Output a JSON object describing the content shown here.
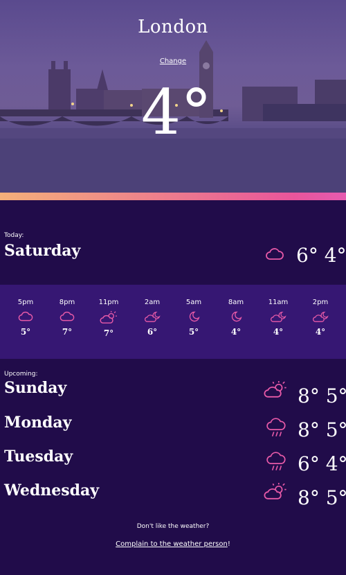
{
  "header": {
    "city": "London",
    "change_label": "Change",
    "current_temp": "4°"
  },
  "today": {
    "label": "Today:",
    "day": "Saturday",
    "icon": "cloud-icon",
    "high": "6°",
    "low": "4°"
  },
  "hourly": [
    {
      "time": "5pm",
      "icon": "cloud-icon",
      "temp": "5°"
    },
    {
      "time": "8pm",
      "icon": "cloud-icon",
      "temp": "7°"
    },
    {
      "time": "11pm",
      "icon": "partly-cloudy-sun-icon",
      "temp": "7°"
    },
    {
      "time": "2am",
      "icon": "partly-cloudy-moon-icon",
      "temp": "6°"
    },
    {
      "time": "5am",
      "icon": "moon-icon",
      "temp": "5°"
    },
    {
      "time": "8am",
      "icon": "moon-icon",
      "temp": "4°"
    },
    {
      "time": "11am",
      "icon": "partly-cloudy-moon-icon",
      "temp": "4°"
    },
    {
      "time": "2pm",
      "icon": "partly-cloudy-moon-icon",
      "temp": "4°"
    }
  ],
  "upcoming": {
    "label": "Upcoming:",
    "days": [
      {
        "day": "Sunday",
        "icon": "partly-cloudy-sun-icon",
        "high": "8°",
        "low": "5°"
      },
      {
        "day": "Monday",
        "icon": "rain-cloud-icon",
        "high": "8°",
        "low": "5°"
      },
      {
        "day": "Tuesday",
        "icon": "rain-cloud-icon",
        "high": "6°",
        "low": "4°"
      },
      {
        "day": "Wednesday",
        "icon": "partly-cloudy-sun-icon",
        "high": "8°",
        "low": "5°"
      }
    ]
  },
  "footer": {
    "question": "Don't like the weather?",
    "link_text": "Complain to the weather person",
    "link_suffix": "!"
  },
  "colors": {
    "background": "#210c4a",
    "hourly_band": "#361773",
    "accent_icon": "#e85aa8",
    "gradient_start": "#f4b07a",
    "gradient_end": "#e55bb0"
  }
}
